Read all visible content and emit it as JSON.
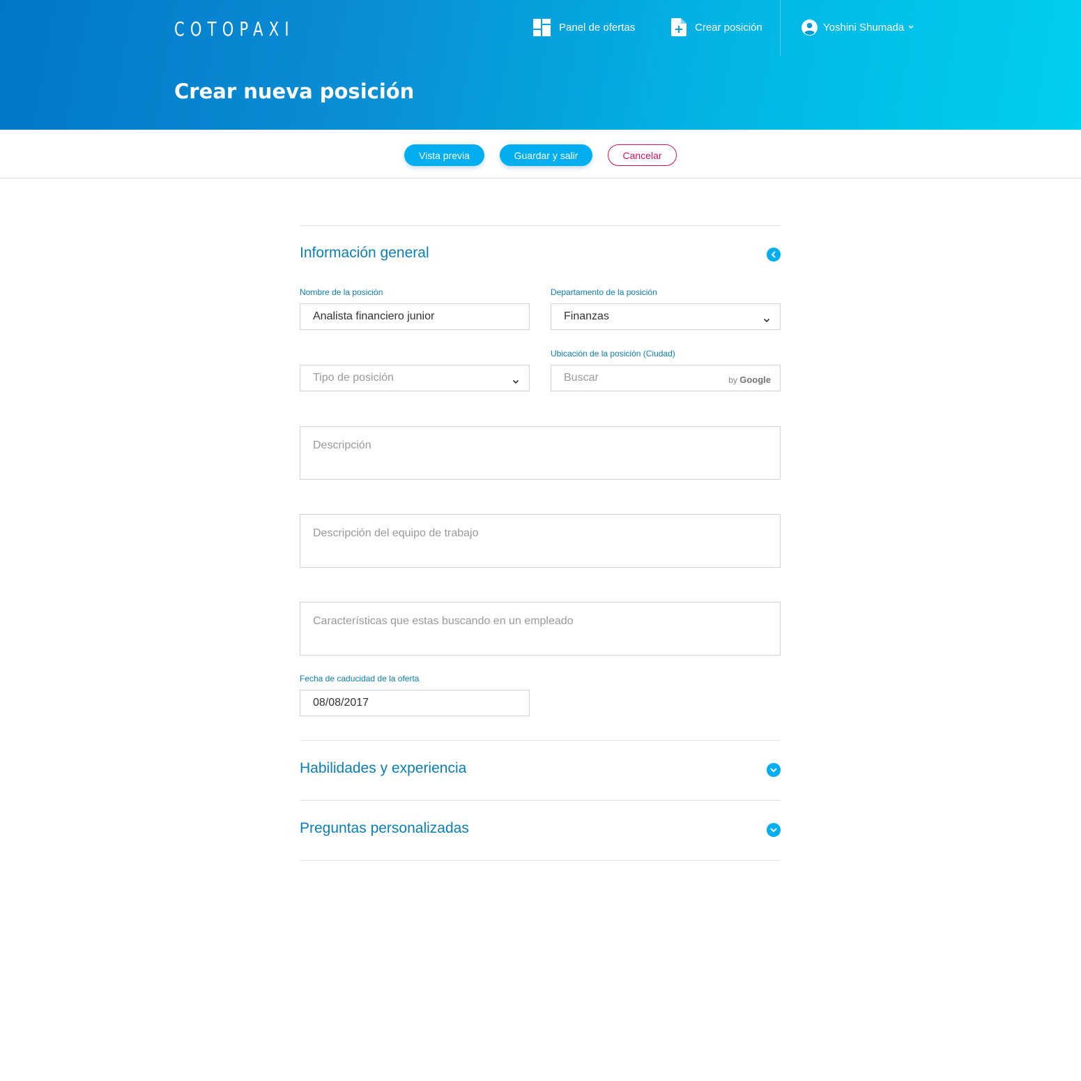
{
  "brand": {
    "logo": "COTOPAXI"
  },
  "nav": {
    "panel_label": "Panel de ofertas",
    "create_label": "Crear posición",
    "user_name": "Yoshini Shumada"
  },
  "page": {
    "title": "Crear nueva posición"
  },
  "toolbar": {
    "preview_label": "Vista previa",
    "save_label": "Guardar y salir",
    "cancel_label": "Cancelar"
  },
  "sections": {
    "general": {
      "title": "Información general",
      "position_name": {
        "label": "Nombre de la posiciòn",
        "value": "Analista financiero junior"
      },
      "department": {
        "label": "Departamento de la posición",
        "value": "Finanzas"
      },
      "position_type": {
        "placeholder": "Tipo de posición"
      },
      "location": {
        "label": "Ubicación de la posición (Ciudad)",
        "placeholder": "Buscar",
        "by": "by",
        "provider": "Google"
      },
      "description": {
        "placeholder": "Descripción"
      },
      "team_description": {
        "placeholder": "Descripción  del equipo de trabajo"
      },
      "characteristics": {
        "placeholder": "Características que estas buscando en un empleado"
      },
      "expiry": {
        "label": "Fecha de caducidad de la oferta",
        "value": "08/08/2017"
      }
    },
    "skills": {
      "title": "Habilidades y experiencia"
    },
    "questions": {
      "title": "Preguntas personalizadas"
    }
  },
  "colors": {
    "accent": "#00aef0",
    "section_text": "#0a7fb5",
    "cancel": "#d6105b",
    "header_start": "#0277c6",
    "header_end": "#00cfee"
  },
  "icons": {
    "panel": "dashboard-icon",
    "create": "file-plus-icon",
    "user": "account-circle-icon",
    "collapse": "chevron-left-icon",
    "expand": "chevron-down-icon"
  }
}
